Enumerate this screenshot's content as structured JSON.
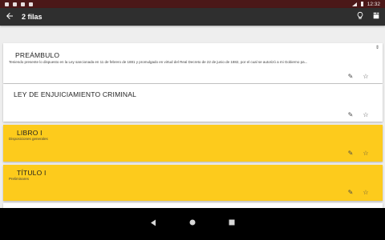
{
  "status_bar": {
    "time": "12:32"
  },
  "app_bar": {
    "title": "2 filas"
  },
  "cards": [
    {
      "heading": "PREÁMBULO",
      "subtitle": "Teniendo presente lo dispuesto en la Ley sancionada en 11 de febrero de 1881 y promulgado en virtud del Real Decreto de 22 de junio de 1882, por el cual se autorizó a mi Gobierno pa..."
    },
    {
      "heading": "LEY DE ENJUICIAMIENTO CRIMINAL",
      "subtitle": ""
    },
    {
      "heading": "LIBRO I",
      "subtitle": "Disposiciones generales"
    },
    {
      "heading": "TÍTULO I",
      "subtitle": "Preliminares"
    }
  ],
  "colors": {
    "appbar": "#2f2f2f",
    "statusbar": "#4b1818",
    "highlight": "#fdcb1c",
    "card": "#ffffff"
  },
  "icons": {
    "back": "arrow-back-icon",
    "bulb": "lightbulb-icon",
    "archive": "document-stack-icon",
    "edit": "pencil-icon",
    "star": "star-outline-icon",
    "nav_back": "triangle-back-icon",
    "nav_home": "circle-home-icon",
    "nav_recents": "square-recents-icon"
  }
}
